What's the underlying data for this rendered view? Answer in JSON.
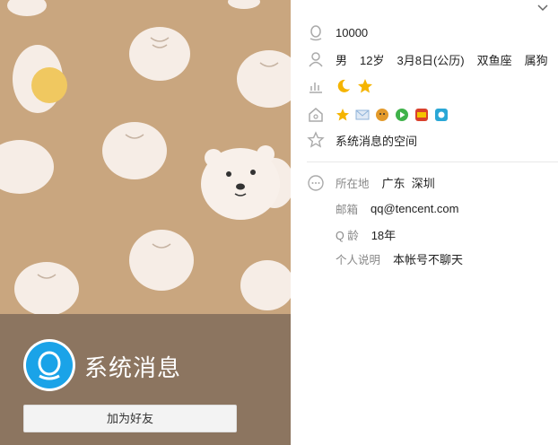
{
  "profile": {
    "qq_number": "10000",
    "display_name": "系统消息",
    "add_friend_label": "加为好友",
    "gender": "男",
    "age": "12岁",
    "birthday": "3月8日(公历)",
    "zodiac": "双鱼座",
    "chinese_zodiac": "属狗",
    "signature": "系统消息的空间"
  },
  "level_icons": [
    "moon-icon",
    "star-icon"
  ],
  "service_badges": [
    {
      "name": "yellow-star-badge",
      "color": "#f5b400"
    },
    {
      "name": "mail-badge",
      "color": "#8fb3d9"
    },
    {
      "name": "pet-badge",
      "color": "#e39a2b"
    },
    {
      "name": "video-badge",
      "color": "#3fb24a"
    },
    {
      "name": "game-badge",
      "color": "#d9412d"
    },
    {
      "name": "music-badge",
      "color": "#2aa7d6"
    }
  ],
  "details": {
    "location_label": "所在地",
    "location_value": "广东  深圳",
    "email_label": "邮箱",
    "email_value": "qq@tencent.com",
    "qage_label": "Q 龄",
    "qage_value": "18年",
    "bio_label": "个人说明",
    "bio_value": "本帐号不聊天"
  },
  "colors": {
    "cover_bg": "#c9a67f",
    "overlay": "#8c7560",
    "accent": "#1aa3e8",
    "bun": "#f6ede6"
  }
}
